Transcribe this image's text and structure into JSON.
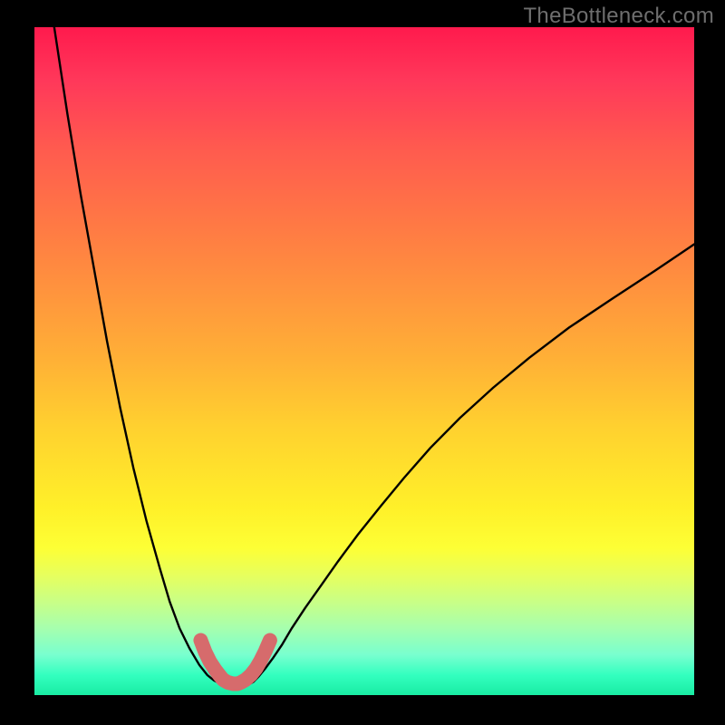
{
  "watermark": "TheBottleneck.com",
  "chart_data": {
    "type": "line",
    "title": "",
    "xlabel": "",
    "ylabel": "",
    "xlim": [
      0,
      100
    ],
    "ylim": [
      0,
      100
    ],
    "annotations": [],
    "series": [
      {
        "name": "left-curve",
        "x": [
          3,
          5,
          7,
          9,
          11,
          13,
          15,
          17,
          19,
          20.5,
          22,
          23.5,
          25,
          26.2,
          27.2,
          28,
          28.6
        ],
        "values": [
          100,
          87,
          75,
          64,
          53,
          43,
          34,
          26,
          19,
          14,
          10,
          7,
          4.5,
          3,
          2.2,
          1.8,
          1.6
        ]
      },
      {
        "name": "right-curve",
        "x": [
          32.5,
          33.2,
          34,
          35,
          36.2,
          37.5,
          39,
          41,
          43.5,
          46,
          49,
          52.5,
          56,
          60,
          64.5,
          69.5,
          75,
          81,
          87.5,
          94,
          100
        ],
        "values": [
          1.6,
          2,
          2.8,
          4,
          5.6,
          7.5,
          10,
          13,
          16.5,
          20,
          24,
          28.3,
          32.5,
          37,
          41.5,
          46,
          50.5,
          55,
          59.3,
          63.5,
          67.5
        ]
      },
      {
        "name": "valley-highlight",
        "x": [
          25.2,
          25.9,
          26.6,
          27.4,
          28.1,
          28.6,
          29.3,
          30.1,
          30.8,
          31.3,
          32,
          32.8,
          33.6,
          34.3,
          35,
          35.7
        ],
        "values": [
          8.2,
          6.4,
          5,
          3.8,
          2.9,
          2.3,
          1.9,
          1.7,
          1.7,
          1.9,
          2.3,
          3,
          4,
          5.2,
          6.6,
          8.2
        ]
      }
    ],
    "background_gradient": {
      "top": "#ff1a4d",
      "mid": "#ffd12f",
      "bottom": "#19eca3"
    }
  }
}
